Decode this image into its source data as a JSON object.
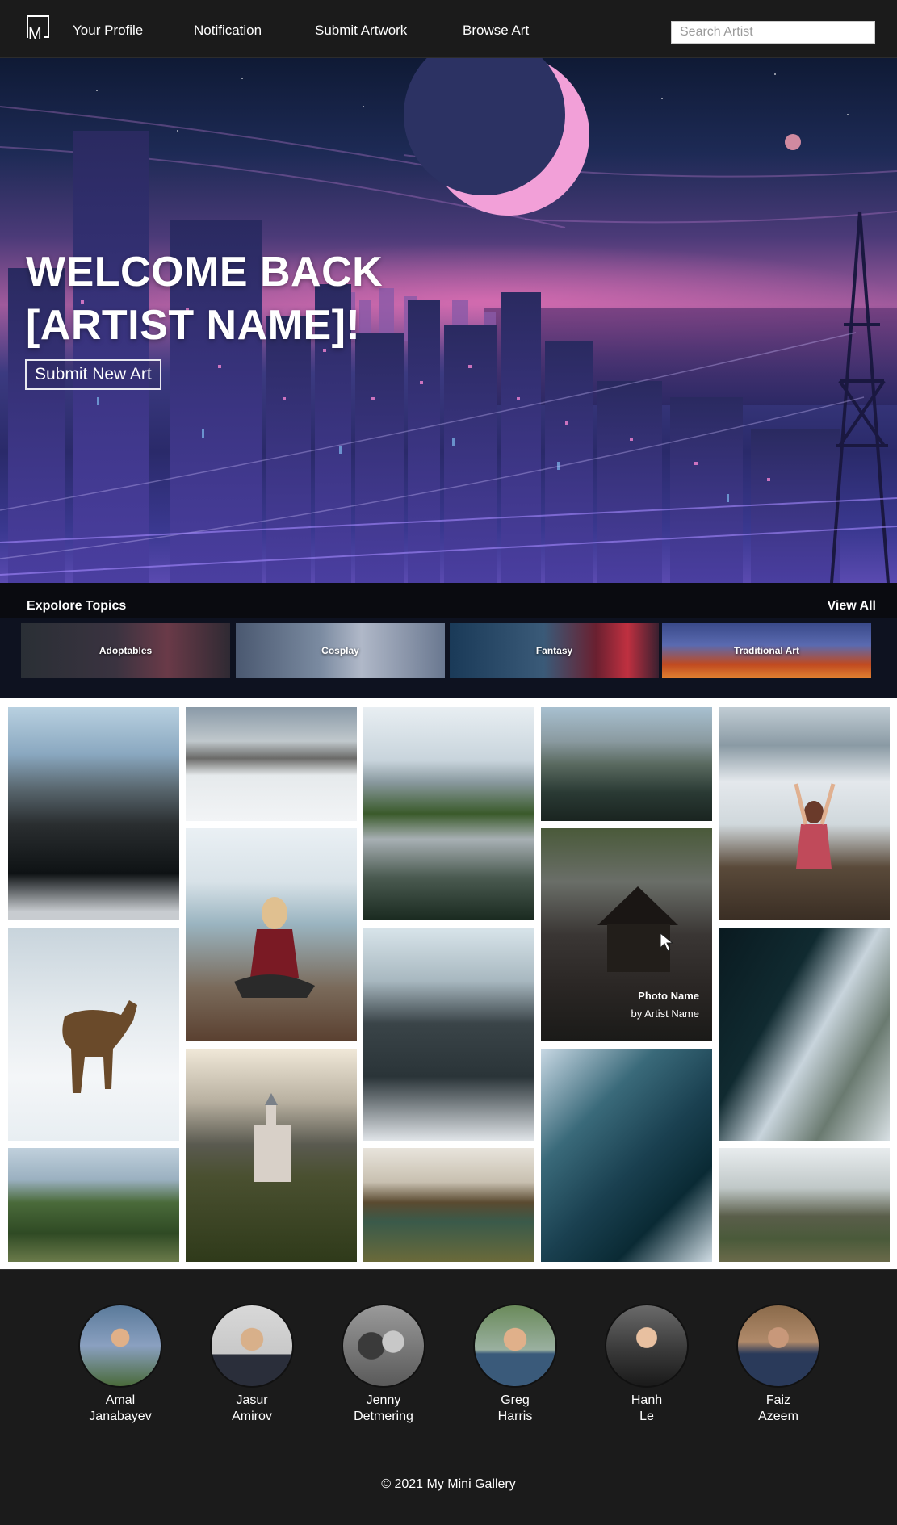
{
  "nav": {
    "logo_text": "M",
    "links": [
      "Your Profile",
      "Notification",
      "Submit Artwork",
      "Browse Art"
    ],
    "search_placeholder": "Search Artist"
  },
  "hero": {
    "title_line1": "WELCOME BACK",
    "title_line2": "[ARTIST NAME]!",
    "button_label": "Submit New Art"
  },
  "topics": {
    "heading": "Expolore Topics",
    "view_all": "View All",
    "items": [
      "Adoptables",
      "Cosplay",
      "Fantasy",
      "Traditional Art"
    ]
  },
  "gallery": {
    "hover": {
      "title": "Photo Name",
      "subtitle": "by Artist Name"
    }
  },
  "team": [
    {
      "first": "Amal",
      "last": "Janabayev"
    },
    {
      "first": "Jasur",
      "last": "Amirov"
    },
    {
      "first": "Jenny",
      "last": "Detmering"
    },
    {
      "first": "Greg",
      "last": "Harris"
    },
    {
      "first": "Hanh",
      "last": "Le"
    },
    {
      "first": "Faiz",
      "last": "Azeem"
    }
  ],
  "footer": {
    "copyright": "© 2021 My Mini Gallery"
  }
}
